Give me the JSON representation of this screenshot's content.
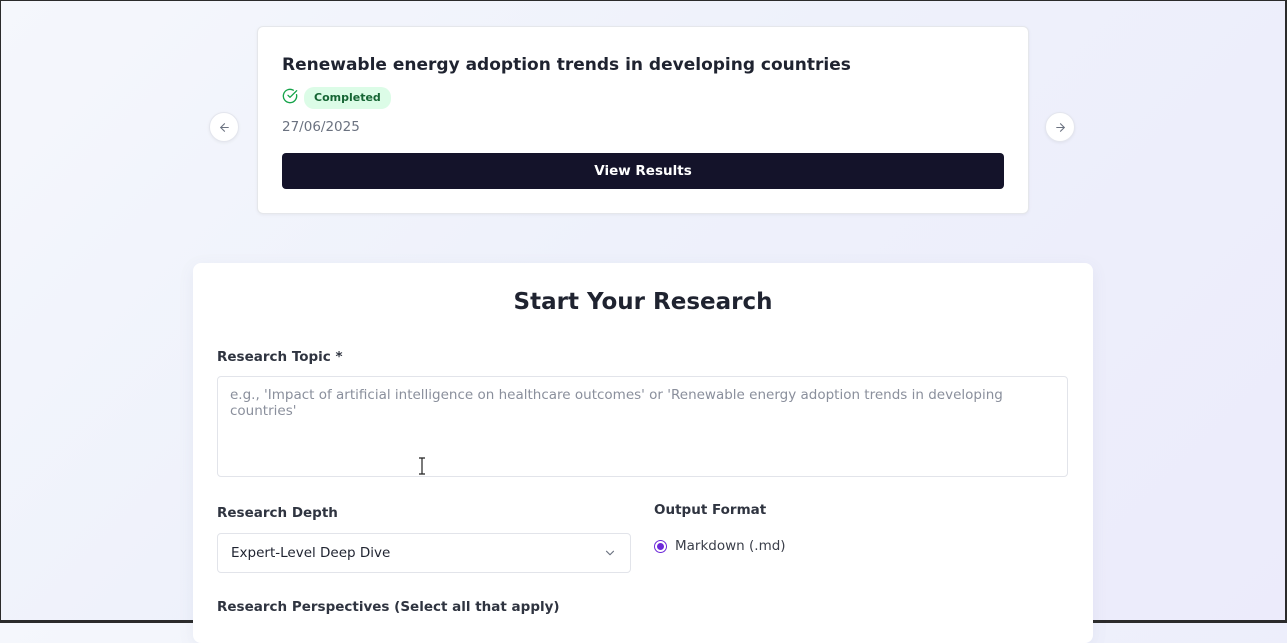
{
  "carousel": {
    "prev_icon": "arrow-left-icon",
    "next_icon": "arrow-right-icon",
    "card": {
      "title": "Renewable energy adoption trends in developing countries",
      "status": "Completed",
      "status_icon": "check-circle-icon",
      "date": "27/06/2025",
      "view_button": "View Results"
    }
  },
  "form": {
    "title": "Start Your Research",
    "topic": {
      "label": "Research Topic *",
      "value": "",
      "placeholder": "e.g., 'Impact of artificial intelligence on healthcare outcomes' or 'Renewable energy adoption trends in developing countries'"
    },
    "depth": {
      "label": "Research Depth",
      "selected": "Expert-Level Deep Dive"
    },
    "output_format": {
      "label": "Output Format",
      "options": [
        {
          "label": "Markdown (.md)",
          "selected": true
        }
      ]
    },
    "perspectives": {
      "label": "Research Perspectives (Select all that apply)"
    }
  },
  "colors": {
    "primary_button": "#14132a",
    "status_bg": "#dcfce7",
    "status_text": "#166534",
    "radio_accent": "#6d28d9"
  }
}
